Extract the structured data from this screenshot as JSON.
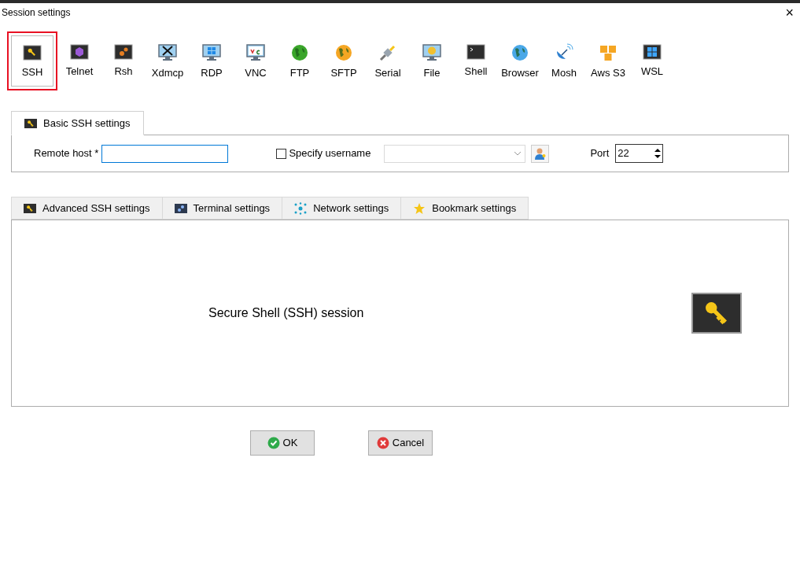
{
  "window": {
    "title": "Session settings",
    "close": "×"
  },
  "session_types": [
    {
      "label": "SSH",
      "selected": true
    },
    {
      "label": "Telnet",
      "selected": false
    },
    {
      "label": "Rsh",
      "selected": false
    },
    {
      "label": "Xdmcp",
      "selected": false
    },
    {
      "label": "RDP",
      "selected": false
    },
    {
      "label": "VNC",
      "selected": false
    },
    {
      "label": "FTP",
      "selected": false
    },
    {
      "label": "SFTP",
      "selected": false
    },
    {
      "label": "Serial",
      "selected": false
    },
    {
      "label": "File",
      "selected": false
    },
    {
      "label": "Shell",
      "selected": false
    },
    {
      "label": "Browser",
      "selected": false
    },
    {
      "label": "Mosh",
      "selected": false
    },
    {
      "label": "Aws S3",
      "selected": false
    },
    {
      "label": "WSL",
      "selected": false
    }
  ],
  "basic_tab": {
    "label": "Basic SSH settings",
    "selected": true
  },
  "basic": {
    "remote_host_label": "Remote host *",
    "specify_username": {
      "label": "Specify username",
      "checked": false
    },
    "port_label": "Port",
    "port_value": "22"
  },
  "advanced_tabs": [
    {
      "label": "Advanced SSH settings",
      "selected": false
    },
    {
      "label": "Terminal settings",
      "selected": false
    },
    {
      "label": "Network settings",
      "selected": false
    },
    {
      "label": "Bookmark settings",
      "selected": false
    }
  ],
  "description": "Secure Shell (SSH) session",
  "buttons": [
    {
      "label": "OK",
      "kind": "ok"
    },
    {
      "label": "Cancel",
      "kind": "cancel"
    }
  ]
}
